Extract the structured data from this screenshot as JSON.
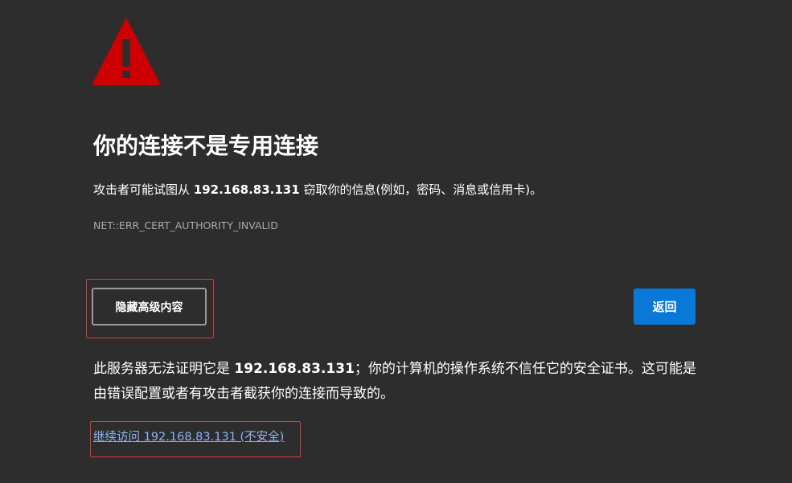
{
  "icon": {
    "name": "warning-triangle-icon",
    "color": "#cc0000"
  },
  "heading": "你的连接不是专用连接",
  "description": {
    "before": "攻击者可能试图从 ",
    "host": "192.168.83.131",
    "after": " 窃取你的信息(例如，密码、消息或信用卡)。"
  },
  "error_code": "NET::ERR_CERT_AUTHORITY_INVALID",
  "buttons": {
    "advanced_label": "隐藏高级内容",
    "back_label": "返回"
  },
  "details": {
    "before": "此服务器无法证明它是 ",
    "host": "192.168.83.131",
    "after": "；你的计算机的操作系统不信任它的安全证书。这可能是由错误配置或者有攻击者截获你的连接而导致的。"
  },
  "proceed_link": "继续访问 192.168.83.131 (不安全)",
  "colors": {
    "background": "#2d2d2d",
    "primary_button": "#0a78d7",
    "link": "#8ab4f8",
    "annotation_box": "#d83a3a"
  }
}
